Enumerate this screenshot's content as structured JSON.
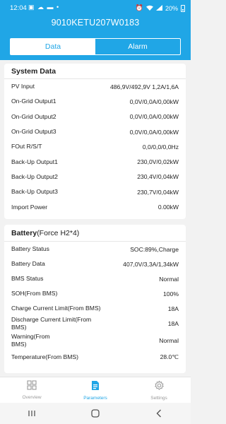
{
  "status_bar": {
    "time": "12:04",
    "battery": "20%"
  },
  "header": {
    "device_id": "9010KETU207W0183"
  },
  "tabs": [
    {
      "label": "Data",
      "active": true
    },
    {
      "label": "Alarm",
      "active": false
    }
  ],
  "system_data": {
    "title": "System Data",
    "rows": [
      {
        "label": "PV Input",
        "value": "486,9V/492,9V 1,2A/1,6A"
      },
      {
        "label": "On-Grid Output1",
        "value": "0,0V/0,0A/0,00kW"
      },
      {
        "label": "On-Grid Output2",
        "value": "0,0V/0,0A/0,00kW"
      },
      {
        "label": "On-Grid Output3",
        "value": "0,0V/0,0A/0,00kW"
      },
      {
        "label": "FOut R/S/T",
        "value": "0,0/0,0/0,0Hz"
      },
      {
        "label": "Back-Up Output1",
        "value": "230,0V/0,02kW"
      },
      {
        "label": "Back-Up Output2",
        "value": "230,4V/0,04kW"
      },
      {
        "label": "Back-Up Output3",
        "value": "230,7V/0,04kW"
      },
      {
        "label": "Import Power",
        "value": "0.00kW"
      }
    ]
  },
  "battery": {
    "title": "Battery",
    "subtitle": "(Force H2*4)",
    "rows": [
      {
        "label": "Battery Status",
        "value": "SOC:89%,Charge"
      },
      {
        "label": "Battery Data",
        "value": "407,0V/3,3A/1,34kW"
      },
      {
        "label": "BMS Status",
        "value": "Normal"
      },
      {
        "label": "SOH(From BMS)",
        "value": "100%"
      },
      {
        "label": "Charge Current Limit(From BMS)",
        "value": "18A"
      },
      {
        "label": "Discharge Current Limit(From BMS)",
        "value": "18A"
      },
      {
        "label": "Warning(From BMS)",
        "value": "Normal"
      },
      {
        "label": "Temperature(From BMS)",
        "value": "28.0℃"
      }
    ]
  },
  "bottom_nav": [
    {
      "label": "Overview",
      "icon": "grid-icon",
      "active": false
    },
    {
      "label": "Parameters",
      "icon": "document-icon",
      "active": true
    },
    {
      "label": "Settings",
      "icon": "gear-icon",
      "active": false
    }
  ],
  "colors": {
    "accent": "#20a6e6",
    "background": "#f2f2f2",
    "inactive": "#999999"
  }
}
